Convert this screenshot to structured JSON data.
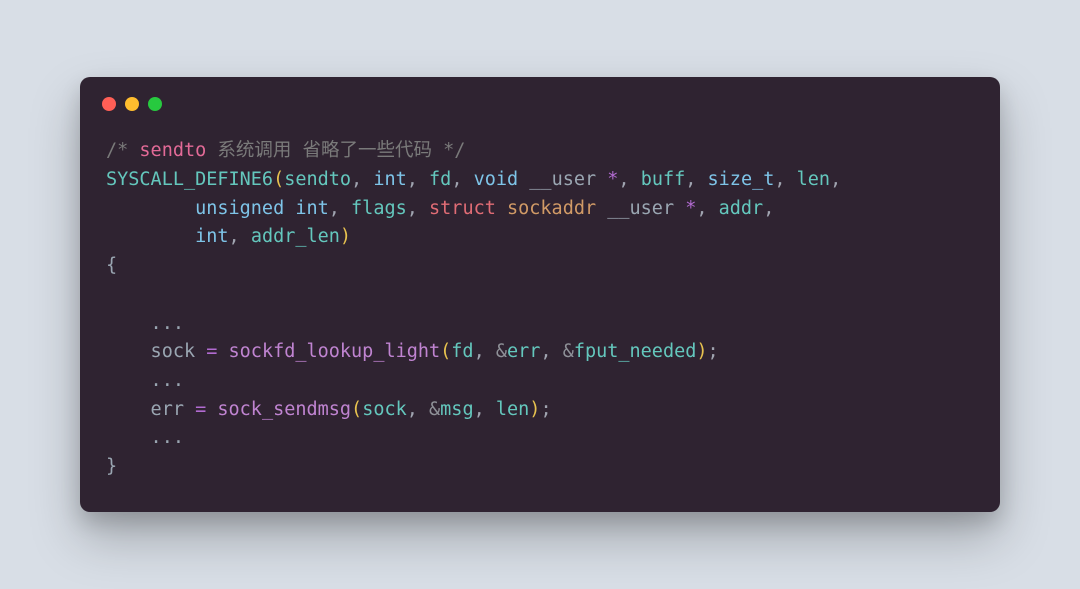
{
  "colors": {
    "page_bg": "#d8dee6",
    "window_bg": "#2f2331",
    "traffic_red": "#ff5f56",
    "traffic_yellow": "#ffbd2e",
    "traffic_green": "#27c93f"
  },
  "comment": {
    "open": "/* ",
    "kw": "sendto",
    "rest": " 系统调用 省略了一些代码 */"
  },
  "sig": {
    "macro": "SYSCALL_DEFINE6",
    "lparen": "(",
    "name": "sendto",
    "c1": ", ",
    "t_int1": "int",
    "c2": ", ",
    "p_fd": "fd",
    "c3": ", ",
    "t_void": "void",
    "sp1": " ",
    "user1": "__user",
    "sp2": " ",
    "star1": "*",
    "c4": ", ",
    "p_buff": "buff",
    "c5": ", ",
    "t_size": "size_t",
    "c6": ", ",
    "p_len": "len",
    "c7": ",",
    "indent2": "        ",
    "t_uint": "unsigned int",
    "c8": ", ",
    "p_flags": "flags",
    "c9": ", ",
    "t_struct": "struct",
    "sp3": " ",
    "t_sockaddr": "sockaddr",
    "sp4": " ",
    "user2": "__user",
    "sp5": " ",
    "star2": "*",
    "c10": ", ",
    "p_addr": "addr",
    "c11": ",",
    "indent3": "        ",
    "t_int2": "int",
    "c12": ", ",
    "p_addrlen": "addr_len",
    "rparen": ")"
  },
  "body": {
    "lbrace": "{",
    "ell1": "    ...",
    "l1_lhs": "    sock ",
    "l1_eq": "=",
    "l1_sp": " ",
    "l1_fn": "sockfd_lookup_light",
    "l1_lp": "(",
    "l1_a1": "fd",
    "l1_c1": ", ",
    "l1_amp1": "&",
    "l1_a2": "err",
    "l1_c2": ", ",
    "l1_amp2": "&",
    "l1_a3": "fput_needed",
    "l1_rp": ")",
    "l1_semi": ";",
    "ell2": "    ...",
    "l2_lhs": "    err ",
    "l2_eq": "=",
    "l2_sp": " ",
    "l2_fn": "sock_sendmsg",
    "l2_lp": "(",
    "l2_a1": "sock",
    "l2_c1": ", ",
    "l2_amp1": "&",
    "l2_a2": "msg",
    "l2_c2": ", ",
    "l2_a3": "len",
    "l2_rp": ")",
    "l2_semi": ";",
    "ell3": "    ...",
    "rbrace": "}"
  }
}
